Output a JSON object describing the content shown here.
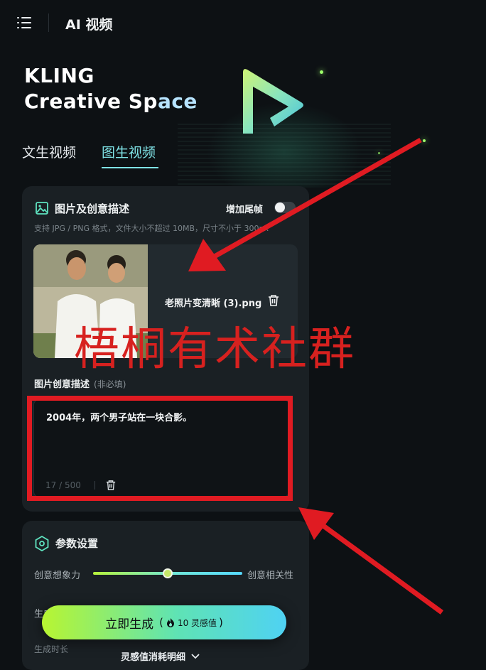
{
  "topbar": {
    "title": "AI 视频"
  },
  "hero": {
    "brand_line1": "KLING",
    "brand_line2_a": "Creative Sp",
    "brand_line2_b": "ace"
  },
  "tabs": [
    {
      "label": "文生视频"
    },
    {
      "label": "图生视频"
    }
  ],
  "image_card": {
    "title": "图片及创意描述",
    "end_frame_label": "增加尾帧",
    "end_frame_enabled": false,
    "hint": "支持 JPG / PNG 格式，文件大小不超过 10MB，尺寸不小于 300px",
    "file_name": "老照片变清晰 (3).png",
    "desc_label": "图片创意描述",
    "desc_optional": "(非必填)",
    "desc_value": "2004年，两个男子站在一块合影。",
    "counter": "17 / 500"
  },
  "params_card": {
    "title": "参数设置",
    "slider_left": "创意想象力",
    "slider_right": "创意相关性",
    "slider_value": 0.5,
    "mode_label": "生成",
    "duration_label": "生成时长"
  },
  "generate": {
    "label": "立即生成",
    "cost": "10 灵感值"
  },
  "footer": {
    "link": "灵感值消耗明细"
  },
  "overlay": {
    "watermark": "梧桐有术社群"
  },
  "colors": {
    "accent": "#7fe3e6",
    "annotation": "#e01b22",
    "background": "#0d1114"
  },
  "icons": [
    "menu-icon",
    "image-icon",
    "trash-icon",
    "settings-hexagon-icon",
    "fire-icon",
    "chevron-down-icon"
  ]
}
